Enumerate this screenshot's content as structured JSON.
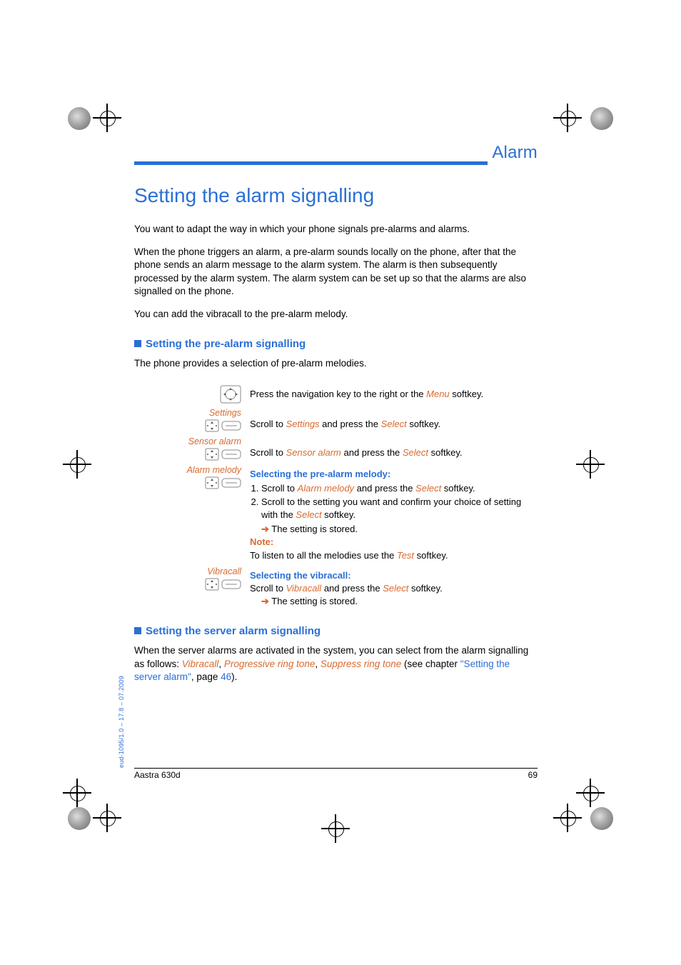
{
  "header": {
    "section": "Alarm"
  },
  "title": "Setting the alarm signalling",
  "intro": {
    "p1": "You want to adapt the way in which your phone signals pre-alarms and alarms.",
    "p2": "When the phone triggers an alarm, a pre-alarm sounds locally on the phone, after that the phone sends an alarm message to the alarm system. The alarm is then subsequently processed by the alarm system. The alarm system can be set up so that the alarms are also signalled on the phone.",
    "p3": "You can add the vibracall to the pre-alarm melody."
  },
  "section1": {
    "heading": "Setting the pre-alarm signalling",
    "lead": "The phone provides a selection of pre-alarm melodies.",
    "step_nav": {
      "t1": "Press the navigation key to the right or the ",
      "menu": "Menu",
      "t2": " softkey."
    },
    "step_settings": {
      "label": "Settings",
      "t1": "Scroll to ",
      "link": "Settings",
      "t2": " and press the ",
      "select": "Select",
      "t3": " softkey."
    },
    "step_sensor": {
      "label": "Sensor alarm",
      "t1": "Scroll to ",
      "link": "Sensor alarm",
      "t2": " and press the ",
      "select": "Select",
      "t3": " softkey."
    },
    "step_melody": {
      "label": "Alarm melody",
      "head": "Selecting the pre-alarm melody:",
      "li1a": "Scroll to ",
      "li1b": "Alarm melody",
      "li1c": " and press the ",
      "li1d": "Select",
      "li1e": " softkey.",
      "li2a": "Scroll to the setting you want and confirm your choice of setting with the ",
      "li2b": "Select",
      "li2c": " softkey.",
      "stored": " The setting is stored.",
      "note_label": "Note:",
      "note_t1": "To listen to all the melodies use the ",
      "note_test": "Test",
      "note_t2": " softkey."
    },
    "step_vibra": {
      "label": "Vibracall",
      "head": "Selecting the vibracall:",
      "t1": "Scroll to ",
      "link": "Vibracall",
      "t2": " and press the ",
      "select": "Select",
      "t3": " softkey.",
      "stored": " The setting is stored."
    }
  },
  "section2": {
    "heading": "Setting the server alarm signalling",
    "t1": "When the server alarms are activated in the system, you can select from the alarm signalling as follows: ",
    "o1": "Vibracall",
    "o2": "Progressive ring tone",
    "o3": "Suppress ring tone",
    "t2": " (see chapter ",
    "ref": "\"Setting the server alarm\"",
    "t3": ", page ",
    "page": "46",
    "t4": ")."
  },
  "footer": {
    "product": "Aastra 630d",
    "page": "69"
  },
  "doc_id": "eud-1095/1.0 – 17.8 – 07.2009"
}
